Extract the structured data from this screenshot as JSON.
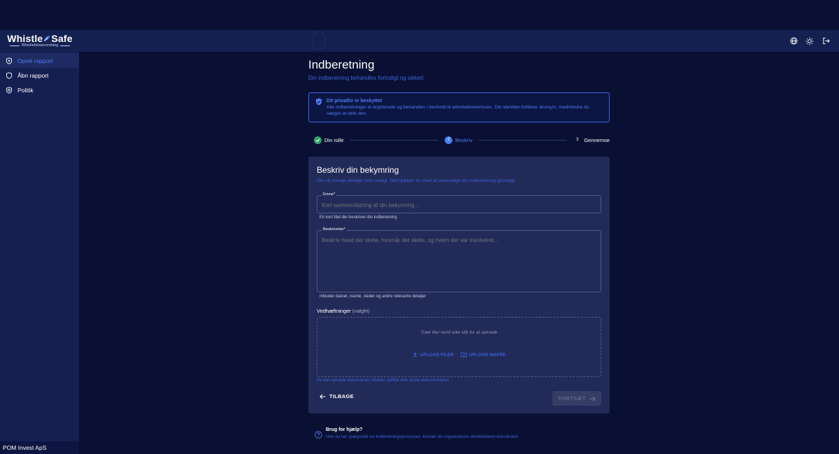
{
  "header": {
    "logo_text": "Whistle",
    "logo_text_2": "Safe",
    "logo_sub": "Whistleblowerordning",
    "icons": [
      "globe-icon",
      "sun-icon",
      "logout-icon"
    ]
  },
  "sidebar": {
    "items": [
      {
        "label": "Opret rapport",
        "icon": "new-report-icon",
        "active": true
      },
      {
        "label": "Åbn rapport",
        "icon": "shield-icon",
        "active": false
      },
      {
        "label": "Politik",
        "icon": "policy-icon",
        "active": false
      }
    ],
    "company": "POM Invest ApS"
  },
  "page": {
    "title": "Indberetning",
    "subtitle": "Din indberetning behandles fortroligt og sikkert"
  },
  "privacy": {
    "title": "Dit privatliv er beskyttet",
    "text": "Alle indberetninger er krypterede og behandles i henhold til whistleblowerloven. Din identitet forbliver anonym, medmindre du vælger at dele den."
  },
  "stepper": {
    "steps": [
      {
        "number": "1",
        "label": "Din rolle",
        "state": "done"
      },
      {
        "number": "2",
        "label": "Beskriv",
        "state": "active"
      },
      {
        "number": "3",
        "label": "Gennemse",
        "state": "pending"
      }
    ]
  },
  "form": {
    "title": "Beskriv din bekymring",
    "subtitle": "Giv så mange detaljer som muligt. Det hjælper os med at undersøge din indberetning grundigt.",
    "subject_label": "Emne*",
    "subject_placeholder": "Kort sammenfatning af din bekymring...",
    "subject_help": "En kort titel der beskriver din indberetning",
    "description_label": "Beskrivelse*",
    "description_placeholder": "Beskriv hvad der skete, hvornår det skete, og hvem der var involveret...",
    "description_help": "Inkluder datoer, navne, steder og andre relevante detaljer",
    "attachments_label": "Vedhæftninger",
    "attachments_optional": "(valgfri)",
    "drop_text": "Træk filer hertil eller klik for at uploade",
    "upload_files": "UPLOAD FILER",
    "upload_folder": "UPLOAD MAPPE",
    "drop_note": "Du kan uploade dokumenter, billeder, lydfiler eller andet dokumentation.",
    "back_label": "TILBAGE",
    "next_label": "FORTSÆT"
  },
  "help": {
    "title": "Brug for hjælp?",
    "text": "Hvis du har spørgsmål om indberetningsprocessen, kontakt din organisations whistleblower-koordinator."
  },
  "colors": {
    "accent": "#3a62d8",
    "success": "#2fa36b",
    "background": "#0a1033",
    "card": "#222a58"
  }
}
